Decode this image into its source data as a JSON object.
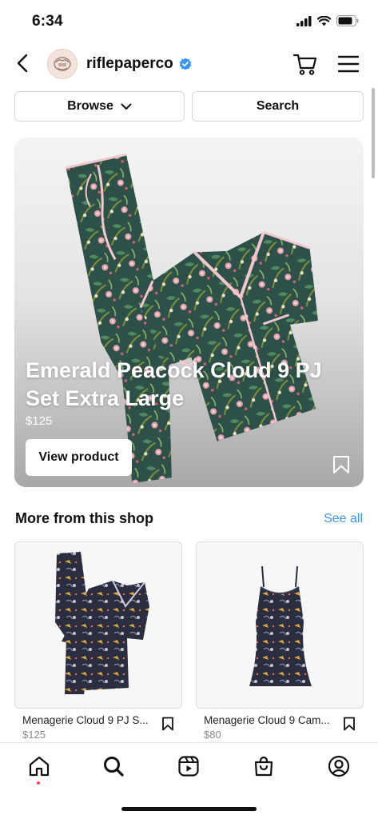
{
  "status_bar": {
    "time": "6:34",
    "battery_level": 0.8
  },
  "header": {
    "shop_name": "riflepaperco",
    "verified": true,
    "accent_color": "#3897f0"
  },
  "top_buttons": {
    "browse_label": "Browse",
    "search_label": "Search"
  },
  "featured": {
    "title": "Emerald Peacock Cloud 9 PJ Set Extra Large",
    "price": "$125",
    "cta_label": "View product"
  },
  "more_section": {
    "title": "More from this shop",
    "see_all_label": "See all",
    "products": [
      {
        "name": "Menagerie Cloud 9 PJ S...",
        "price": "$125"
      },
      {
        "name": "Menagerie Cloud 9 Cam...",
        "price": "$80"
      }
    ]
  },
  "tab_bar": {
    "items": [
      "home-icon",
      "search-icon",
      "reels-icon",
      "shop-bag-icon",
      "profile-icon"
    ],
    "active": "home-icon",
    "notification_color": "#ed4956"
  }
}
